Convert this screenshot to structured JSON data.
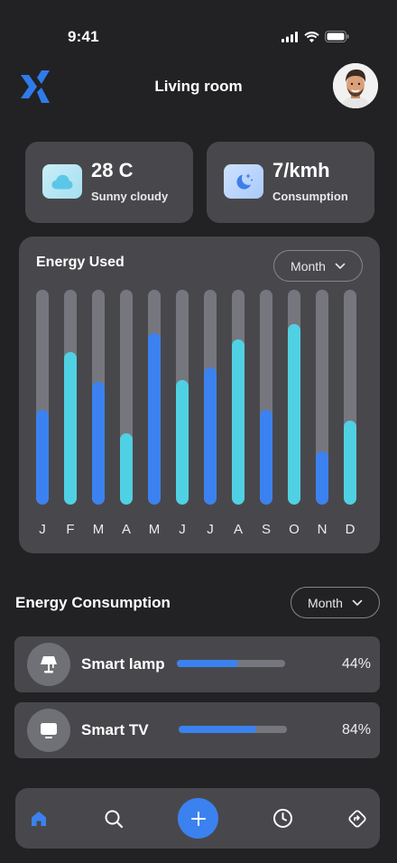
{
  "status_bar": {
    "time": "9:41"
  },
  "header": {
    "title": "Living room"
  },
  "stats": {
    "weather": {
      "value": "28 C",
      "label": "Sunny cloudy",
      "icon": "cloud-icon"
    },
    "consumption": {
      "value": "7/kmh",
      "label": "Consumption",
      "icon": "moon-star-icon"
    }
  },
  "energy_used": {
    "title": "Energy Used",
    "period": "Month"
  },
  "chart_data": {
    "type": "bar",
    "title": "Energy Used",
    "categories": [
      "J",
      "F",
      "M",
      "A",
      "M",
      "J",
      "J",
      "A",
      "S",
      "O",
      "N",
      "D"
    ],
    "values": [
      44,
      71,
      57,
      33,
      80,
      58,
      64,
      77,
      44,
      84,
      25,
      39
    ],
    "ylim": [
      0,
      100
    ],
    "colors": [
      "#3b82f0",
      "#4fd1e3",
      "#3b82f0",
      "#4fd1e3",
      "#3b82f0",
      "#4fd1e3",
      "#3b82f0",
      "#4fd1e3",
      "#3b82f0",
      "#4fd1e3",
      "#3b82f0",
      "#4fd1e3"
    ],
    "track_color": "#76767e",
    "grid": false
  },
  "energy_consumption": {
    "title": "Energy Consumption",
    "period": "Month",
    "devices": [
      {
        "name": "Smart lamp",
        "percent_label": "44%",
        "progress": 0.57,
        "icon": "lamp-icon"
      },
      {
        "name": "Smart TV",
        "percent_label": "84%",
        "progress": 0.72,
        "icon": "tv-icon"
      }
    ]
  },
  "nav": {
    "items": [
      "home-icon",
      "search-icon",
      "add-icon",
      "clock-icon",
      "directions-icon"
    ],
    "active": "home-icon",
    "accent": "#3b82f0"
  }
}
